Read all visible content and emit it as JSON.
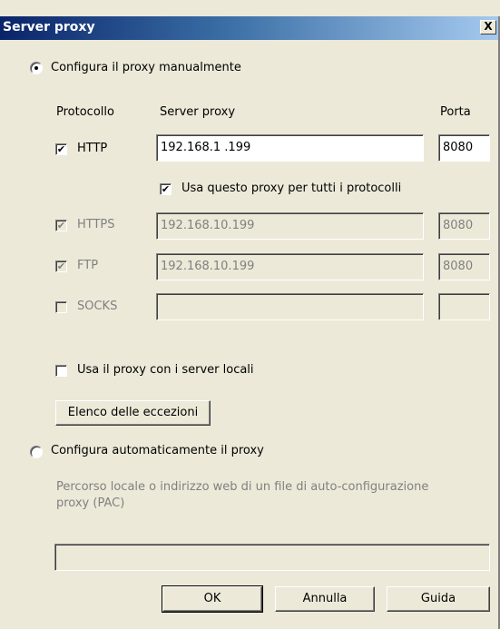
{
  "window": {
    "title": "Server proxy",
    "close_symbol": "X"
  },
  "manual": {
    "radio_label": "Configura il proxy manualmente",
    "selected": true
  },
  "headers": {
    "protocol": "Protocollo",
    "server": "Server proxy",
    "port": "Porta"
  },
  "rows": [
    {
      "label": "HTTP",
      "checked": true,
      "enabled": true,
      "server": "192.168.1  .199",
      "port": "8080"
    },
    {
      "label": "HTTPS",
      "checked": true,
      "enabled": false,
      "server": "192.168.10.199",
      "port": "8080"
    },
    {
      "label": "FTP",
      "checked": true,
      "enabled": false,
      "server": "192.168.10.199",
      "port": "8080"
    },
    {
      "label": "SOCKS",
      "checked": false,
      "enabled": false,
      "server": "",
      "port": ""
    }
  ],
  "use_for_all": {
    "label": "Usa questo proxy per tutti i protocolli",
    "checked": true
  },
  "local_servers": {
    "label": "Usa il proxy con i server locali",
    "checked": false
  },
  "exceptions_button": "Elenco delle eccezioni",
  "auto": {
    "radio_label": "Configura automaticamente il proxy",
    "selected": false,
    "description_line1": "Percorso locale o indirizzo web di un file di auto-configurazione",
    "description_line2": "proxy (PAC)",
    "pac_value": ""
  },
  "buttons": {
    "ok": "OK",
    "cancel": "Annulla",
    "help": "Guida"
  },
  "colors": {
    "title_gradient_start": "#0a246a",
    "title_gradient_end": "#a6caf0",
    "dialog_bg": "#ece9d8",
    "disabled_text": "#808080"
  }
}
